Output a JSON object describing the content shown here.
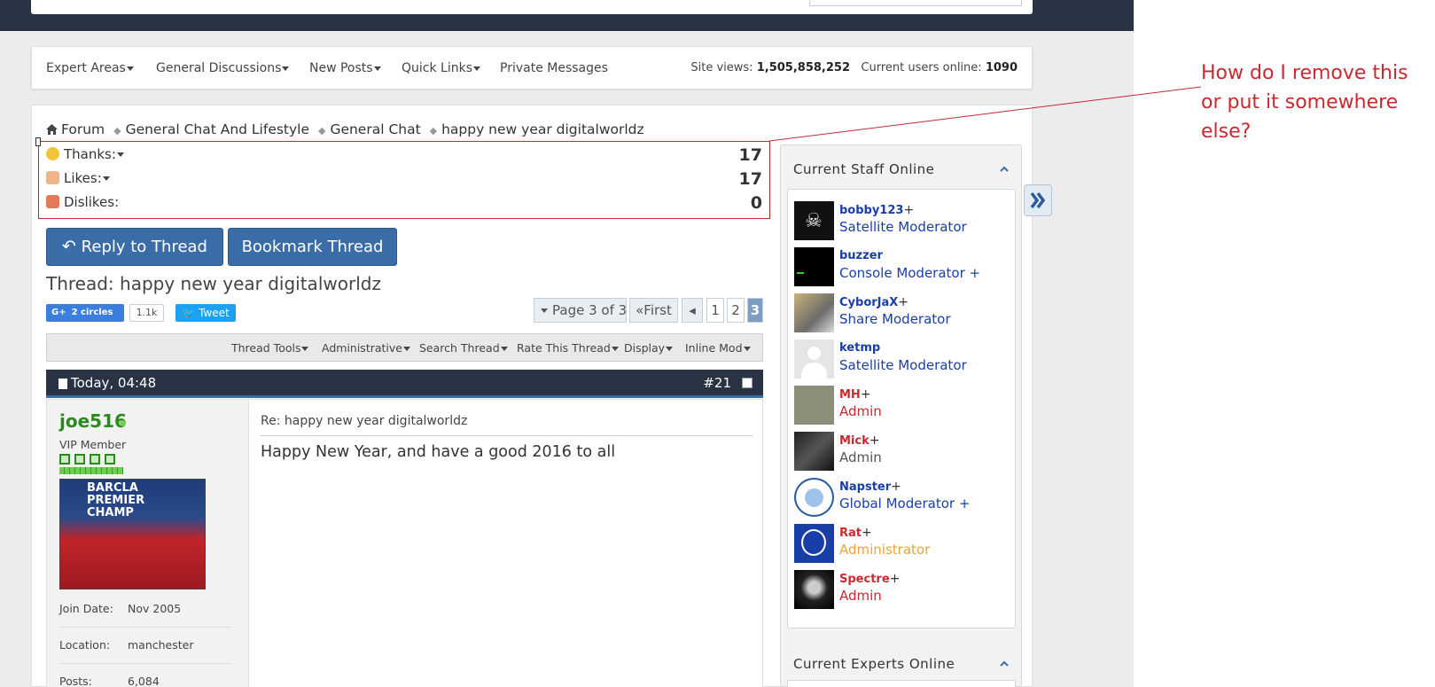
{
  "nav": {
    "items": [
      {
        "label": "Expert Areas"
      },
      {
        "label": "General Discussions"
      },
      {
        "label": "New Posts"
      },
      {
        "label": "Quick Links"
      },
      {
        "label": "Private Messages"
      }
    ],
    "site_views_label": "Site views:",
    "site_views": "1,505,858,252",
    "users_online_label": "Current users online:",
    "users_online": "1090"
  },
  "breadcrumb": [
    "Forum",
    "General Chat And Lifestyle",
    "General Chat",
    "happy new year digitalworldz"
  ],
  "stats": {
    "thanks_label": "Thanks:",
    "thanks": "17",
    "likes_label": "Likes:",
    "likes": "17",
    "dislikes_label": "Dislikes:",
    "dislikes": "0"
  },
  "buttons": {
    "reply": "Reply to Thread",
    "bookmark": "Bookmark Thread"
  },
  "thread": {
    "title": "Thread: happy new year digitalworldz"
  },
  "social": {
    "gplus": "2 circles",
    "gplus_count": "1.1k",
    "tweet": "Tweet"
  },
  "pager": {
    "info": "Page 3 of 3",
    "first": "First",
    "pages": [
      "1",
      "2",
      "3"
    ],
    "current": "3"
  },
  "toolbar": [
    "Thread Tools",
    "Administrative",
    "Search Thread",
    "Rate This Thread",
    "Display",
    "Inline Mod"
  ],
  "post": {
    "date": "Today, 04:48",
    "number": "#21",
    "username": "joe516",
    "usertitle": "VIP Member",
    "join_label": "Join Date:",
    "join_value": "Nov 2005",
    "location_label": "Location:",
    "location_value": "manchester",
    "posts_label": "Posts:",
    "posts_value": "6,084",
    "avatar_text": "BARCLA\nPREMIER\nCHAMP",
    "subject": "Re: happy new year digitalworldz",
    "message": "Happy New Year, and have a good 2016 to all"
  },
  "sidebar": {
    "staff_title": "Current Staff Online",
    "experts_title": "Current Experts Online",
    "staff": [
      {
        "name": "bobby123",
        "role": "Satellite Moderator",
        "name_color": "#1a3ea8",
        "role_color": "#1a3ea8"
      },
      {
        "name": "buzzer",
        "role": "Console Moderator +",
        "name_color": "#1a3ea8",
        "role_color": "#1a3ea8"
      },
      {
        "name": "CyborJaX",
        "role": "Share Moderator",
        "name_color": "#1a3ea8",
        "role_color": "#1a3ea8"
      },
      {
        "name": "ketmp",
        "role": "Satellite Moderator",
        "name_color": "#1a3ea8",
        "role_color": "#1a3ea8"
      },
      {
        "name": "MH",
        "role": "Admin",
        "name_color": "#c9292f",
        "role_color": "#c9292f"
      },
      {
        "name": "Mick",
        "role": "Admin",
        "name_color": "#c9292f",
        "role_color": "#555555"
      },
      {
        "name": "Napster",
        "role": "Global Moderator +",
        "name_color": "#1a3ea8",
        "role_color": "#1a3ea8"
      },
      {
        "name": "Rat",
        "role": "Administrator",
        "name_color": "#c9292f",
        "role_color": "#e8a33a"
      },
      {
        "name": "Spectre",
        "role": "Admin",
        "name_color": "#c9292f",
        "role_color": "#c9292f"
      }
    ]
  },
  "annotation": {
    "text": "How do I remove this or put it somewhere else?"
  },
  "colors": {
    "dark_header": "#2a3344",
    "button_blue": "#3a6da8",
    "annotation_red": "#c9292f",
    "username_green": "#2a8a1e"
  }
}
